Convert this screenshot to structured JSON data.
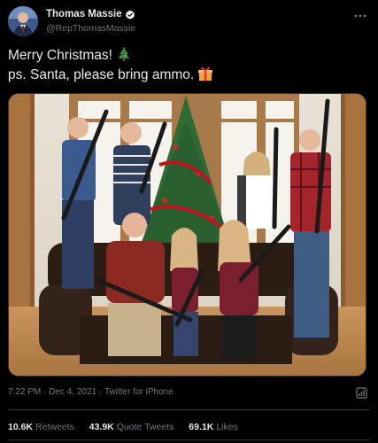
{
  "author": {
    "display_name": "Thomas Massie",
    "handle": "@RepThomasMassie",
    "verified_icon": "verified-badge-icon",
    "avatar_icon": "profile-avatar"
  },
  "tweet": {
    "line1": "Merry Christmas!",
    "line1_emoji": "christmas-tree-emoji",
    "line2": "ps. Santa, please bring ammo.",
    "line2_emoji": "wrapped-gift-emoji"
  },
  "meta": {
    "time": "7:22 PM",
    "sep1": " · ",
    "date": "Dec 4, 2021",
    "sep2": " · ",
    "source": "Twitter for iPhone"
  },
  "stats": {
    "retweets_count": "10.6K",
    "retweets_label": "Retweets",
    "quote_count": "43.9K",
    "quote_label": "Quote Tweets",
    "likes_count": "69.1K",
    "likes_label": "Likes"
  },
  "colors": {
    "background": "#000000",
    "text": "#e7e9ea",
    "secondary": "#71767b",
    "border": "#2f3336",
    "verified": "#1d9bf0"
  }
}
